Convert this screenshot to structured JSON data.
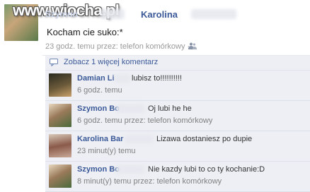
{
  "watermark": "www.wiocha.pl",
  "post": {
    "author_faded": "Szymon",
    "author": "Karolina",
    "text": "Kocham cie suko:*",
    "meta": "23 godz. temu przez: telefon komórkowy · "
  },
  "comments_header": {
    "more_link": "Zobacz 1 więcej komentarz"
  },
  "comments": [
    {
      "name": "Damian Li",
      "text": "lubisz to!!!!!!!!!!",
      "meta": "6 godz. temu"
    },
    {
      "name": "Szymon Bo",
      "text": "Oj lubi he he",
      "meta": "6 godz. temu przez: telefon komórkowy"
    },
    {
      "name": "Karolina Bar",
      "text": "Lizawa dostaniesz po dupie",
      "meta": "23 minut(y) temu"
    },
    {
      "name": "Szymon Bo",
      "text": "Nie kazdy lubi to co ty kochanie:D",
      "meta": "8 minut(y) temu przez: telefon komórkowy"
    }
  ],
  "colors": {
    "link": "#3b5998",
    "comment_bg": "#edeff4"
  },
  "icons": {
    "audience": "people-icon",
    "comments": "speech-bubble-icon"
  }
}
